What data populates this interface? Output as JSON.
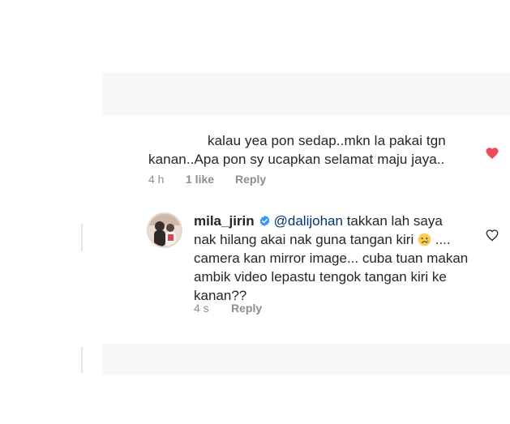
{
  "comment1": {
    "line1": "kalau yea pon sedap..mkn la pakai tgn",
    "line2": "kanan..Apa pon sy ucapkan selamat maju jaya..",
    "time": "4 h",
    "likes": "1 like",
    "reply": "Reply",
    "liked": true,
    "heart_icon": "heart-filled-icon",
    "heart_color": "#ed4956"
  },
  "comment2": {
    "username": "mila_jirin",
    "verified": true,
    "mention": "@dalijohan",
    "line1_rest": "takkan lah saya",
    "line2_before_emoji": "nak hilang akai nak guna tangan kiri",
    "emoji_name": "crying-face-emoji",
    "line2_after_emoji": "....",
    "line3": "camera kan mirror image... cuba tuan makan",
    "line4": "ambik video lepastu tengok tangan kiri ke",
    "line5": "kanan??",
    "time": "4 s",
    "reply": "Reply",
    "liked": false,
    "heart_icon": "heart-outline-icon"
  },
  "colors": {
    "text": "#262626",
    "secondary": "#8e8e8e",
    "mention": "#00376b",
    "verified_badge": "#3897f0",
    "like_red": "#ed4956"
  }
}
